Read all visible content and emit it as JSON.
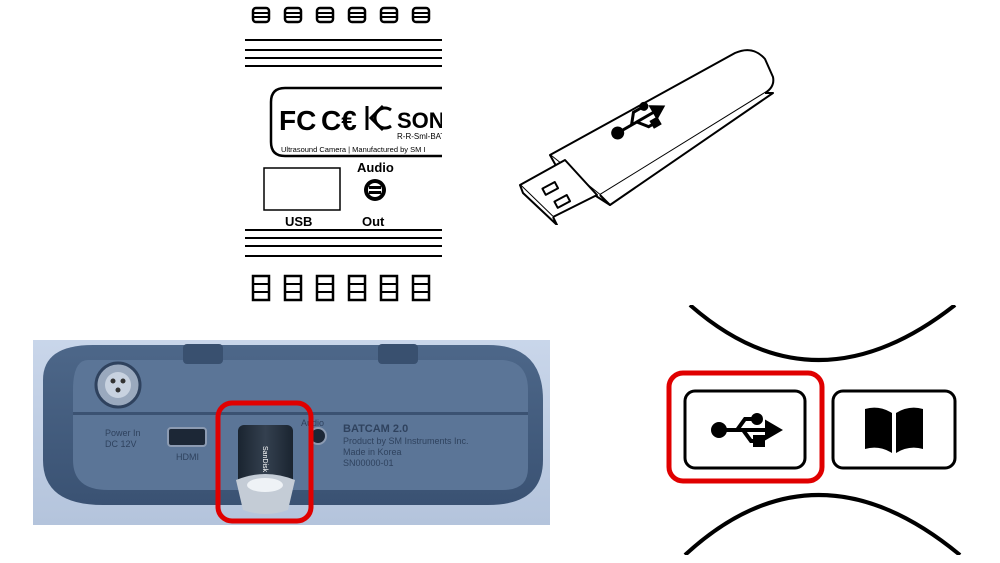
{
  "device_label": {
    "brand": "SONA",
    "model": "R-R-Sml-BAT",
    "description": "Ultrasound Camera  |  Manufactured by SM I",
    "port_usb": "USB",
    "audio_top": "Audio",
    "audio_bottom": "Out"
  },
  "usb_stick": {
    "icon": "usb-symbol-icon"
  },
  "device_photo": {
    "power_line1": "Power In",
    "power_line2": "DC 12V",
    "hdmi": "HDMI",
    "audio": "Audio",
    "info_line1": "BATCAM 2.0",
    "info_line2": "Product by SM Instruments Inc.",
    "info_line3": "Made in Korea",
    "info_line4": "SN00000-01",
    "stick_brand": "SanDisk",
    "highlight_color": "#e00000"
  },
  "ui_buttons": {
    "usb_icon": "usb-icon",
    "manual_icon": "book-icon",
    "highlight_color": "#e00000"
  }
}
